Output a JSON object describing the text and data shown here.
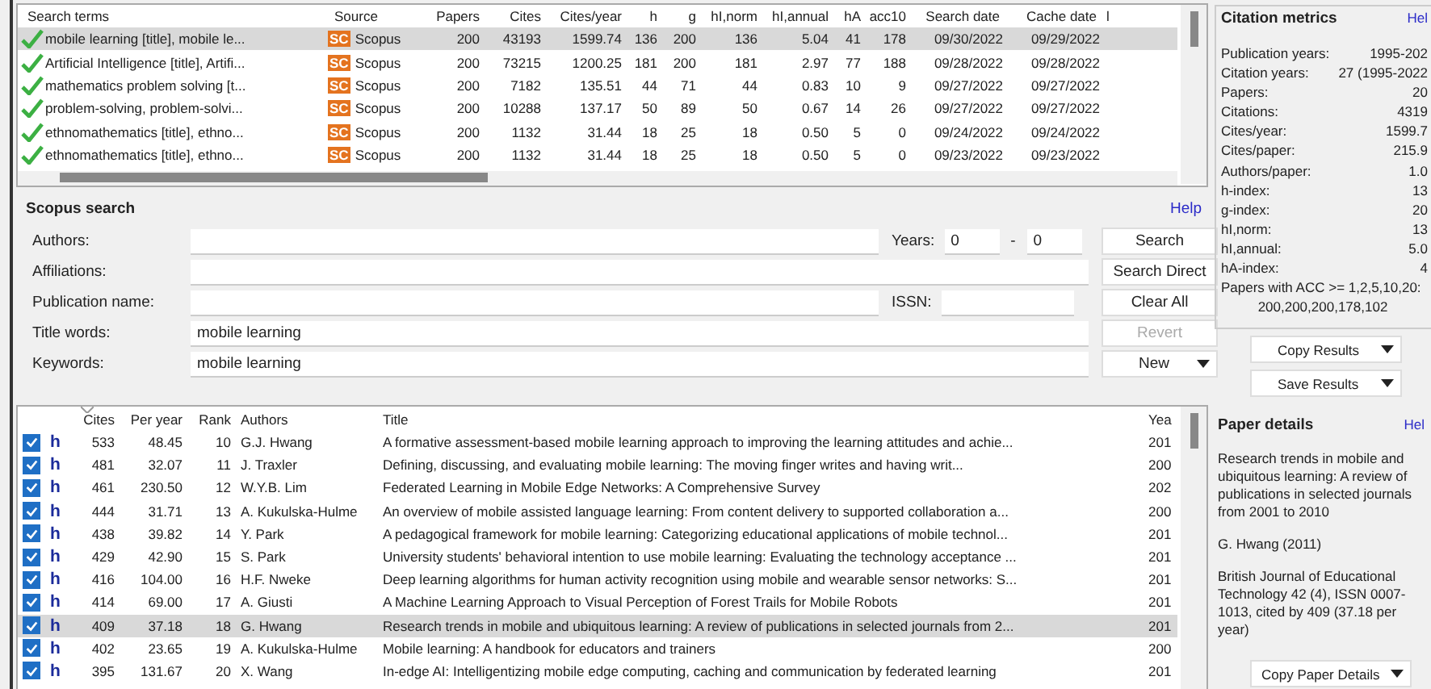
{
  "results_table": {
    "columns": [
      "Search terms",
      "Source",
      "Papers",
      "Cites",
      "Cites/year",
      "h",
      "g",
      "hI,norm",
      "hI,annual",
      "hA",
      "acc10",
      "Search date",
      "Cache date",
      "l"
    ],
    "rows": [
      {
        "selected": true,
        "search_terms": "mobile learning [title], mobile le...",
        "source_badge": "SC",
        "source": "Scopus",
        "values": [
          "200",
          "43193",
          "1599.74",
          "136",
          "200",
          "136",
          "5.04",
          "41",
          "178",
          "09/30/2022",
          "09/29/2022"
        ]
      },
      {
        "selected": false,
        "search_terms": "Artificial Intelligence [title], Artifi...",
        "source_badge": "SC",
        "source": "Scopus",
        "values": [
          "200",
          "73215",
          "1200.25",
          "181",
          "200",
          "181",
          "2.97",
          "77",
          "188",
          "09/28/2022",
          "09/28/2022"
        ]
      },
      {
        "selected": false,
        "search_terms": "mathematics problem solving [t...",
        "source_badge": "SC",
        "source": "Scopus",
        "values": [
          "200",
          "7182",
          "135.51",
          "44",
          "71",
          "44",
          "0.83",
          "10",
          "9",
          "09/27/2022",
          "09/27/2022"
        ]
      },
      {
        "selected": false,
        "search_terms": "problem-solving, problem-solvi...",
        "source_badge": "SC",
        "source": "Scopus",
        "values": [
          "200",
          "10288",
          "137.17",
          "50",
          "89",
          "50",
          "0.67",
          "14",
          "26",
          "09/27/2022",
          "09/27/2022"
        ]
      },
      {
        "selected": false,
        "search_terms": "ethnomathematics [title], ethno...",
        "source_badge": "SC",
        "source": "Scopus",
        "values": [
          "200",
          "1132",
          "31.44",
          "18",
          "25",
          "18",
          "0.50",
          "5",
          "0",
          "09/24/2022",
          "09/24/2022"
        ]
      },
      {
        "selected": false,
        "search_terms": "ethnomathematics [title], ethno...",
        "source_badge": "SC",
        "source": "Scopus",
        "values": [
          "200",
          "1132",
          "31.44",
          "18",
          "25",
          "18",
          "0.50",
          "5",
          "0",
          "09/23/2022",
          "09/23/2022"
        ]
      }
    ]
  },
  "search_panel": {
    "title": "Scopus search",
    "help": "Help",
    "fields": [
      {
        "label": "Authors:"
      },
      {
        "label": "Affiliations:"
      },
      {
        "label": "Publication name:"
      },
      {
        "label": "Title words:",
        "value": "mobile learning"
      },
      {
        "label": "Keywords:",
        "value": "mobile learning"
      }
    ],
    "years": {
      "label": "Years:",
      "from": "0",
      "separator": "-",
      "to": "0"
    },
    "issn": {
      "label": "ISSN:"
    },
    "buttons": [
      {
        "label": "Search",
        "disabled": false,
        "dropdown": false
      },
      {
        "label": "Search Direct",
        "disabled": false,
        "dropdown": false
      },
      {
        "label": "Clear All",
        "disabled": false,
        "dropdown": false
      },
      {
        "label": "Revert",
        "disabled": true,
        "dropdown": false
      },
      {
        "label": "New",
        "disabled": false,
        "dropdown": true
      }
    ]
  },
  "papers_table": {
    "columns": [
      "Cites",
      "Per year",
      "Rank",
      "Authors",
      "Title",
      "Yea"
    ],
    "rows": [
      {
        "checked": true,
        "flag": "h",
        "selected": false,
        "cells": [
          "533",
          "48.45",
          "10",
          "G.J. Hwang",
          "A formative assessment-based mobile learning approach to improving the learning attitudes and achie...",
          "201"
        ]
      },
      {
        "checked": true,
        "flag": "h",
        "selected": false,
        "cells": [
          "481",
          "32.07",
          "11",
          "J. Traxler",
          "Defining, discussing, and evaluating mobile learning: The moving finger writes and having writ...",
          "200"
        ]
      },
      {
        "checked": true,
        "flag": "h",
        "selected": false,
        "cells": [
          "461",
          "230.50",
          "12",
          "W.Y.B. Lim",
          "Federated Learning in Mobile Edge Networks: A Comprehensive Survey",
          "202"
        ]
      },
      {
        "checked": true,
        "flag": "h",
        "selected": false,
        "cells": [
          "444",
          "31.71",
          "13",
          "A. Kukulska-Hulme",
          "An overview of mobile assisted language learning: From content delivery to supported collaboration a...",
          "200"
        ]
      },
      {
        "checked": true,
        "flag": "h",
        "selected": false,
        "cells": [
          "438",
          "39.82",
          "14",
          "Y. Park",
          "A pedagogical framework for mobile learning: Categorizing educational applications of mobile technol...",
          "201"
        ]
      },
      {
        "checked": true,
        "flag": "h",
        "selected": false,
        "cells": [
          "429",
          "42.90",
          "15",
          "S. Park",
          "University students' behavioral intention to use mobile learning: Evaluating the technology acceptance ...",
          "201"
        ]
      },
      {
        "checked": true,
        "flag": "h",
        "selected": false,
        "cells": [
          "416",
          "104.00",
          "16",
          "H.F. Nweke",
          "Deep learning algorithms for human activity recognition using mobile and wearable sensor networks: S...",
          "201"
        ]
      },
      {
        "checked": true,
        "flag": "h",
        "selected": false,
        "cells": [
          "414",
          "69.00",
          "17",
          "A. Giusti",
          "A Machine Learning Approach to Visual Perception of Forest Trails for Mobile Robots",
          "201"
        ]
      },
      {
        "checked": true,
        "flag": "h",
        "selected": true,
        "cells": [
          "409",
          "37.18",
          "18",
          "G. Hwang",
          "Research trends in mobile and ubiquitous learning: A review of publications in selected journals from 2...",
          "201"
        ]
      },
      {
        "checked": true,
        "flag": "h",
        "selected": false,
        "cells": [
          "402",
          "23.65",
          "19",
          "A. Kukulska-Hulme",
          "Mobile learning: A handbook for educators and trainers",
          "200"
        ]
      },
      {
        "checked": true,
        "flag": "h",
        "selected": false,
        "cells": [
          "395",
          "131.67",
          "20",
          "X. Wang",
          "In-edge AI: Intelligentizing mobile edge computing, caching and communication by federated learning",
          "201"
        ]
      }
    ]
  },
  "citation_metrics": {
    "title": "Citation metrics",
    "help": "Hel",
    "items": [
      {
        "label": "Publication years:",
        "value": "1995-202"
      },
      {
        "label": "Citation years:",
        "value": "27 (1995-2022"
      },
      {
        "label": "Papers:",
        "value": "20"
      },
      {
        "label": "Citations:",
        "value": "4319"
      },
      {
        "label": "Cites/year:",
        "value": "1599.7"
      },
      {
        "label": "Cites/paper:",
        "value": "215.9"
      },
      {
        "label": "Authors/paper:",
        "value": "1.0"
      },
      {
        "label": "h-index:",
        "value": "13"
      },
      {
        "label": "g-index:",
        "value": "20"
      },
      {
        "label": "hI,norm:",
        "value": "13"
      },
      {
        "label": "hI,annual:",
        "value": "5.0"
      },
      {
        "label": "hA-index:",
        "value": "4"
      }
    ],
    "acc_label": "Papers with ACC >= 1,2,5,10,20:",
    "acc_value": "200,200,200,178,102"
  },
  "result_buttons": [
    "Copy Results",
    "Save Results"
  ],
  "paper_details": {
    "title": "Paper details",
    "help": "Hel",
    "paragraphs": [
      "Research trends in mobile and ubiquitous learning: A review of publications in selected journals from 2001 to 2010",
      "G. Hwang (2011)",
      "British Journal of Educational Technology 42 (4), ISSN 0007-1013, cited by 409 (37.18 per year)"
    ],
    "button": "Copy Paper Details"
  }
}
